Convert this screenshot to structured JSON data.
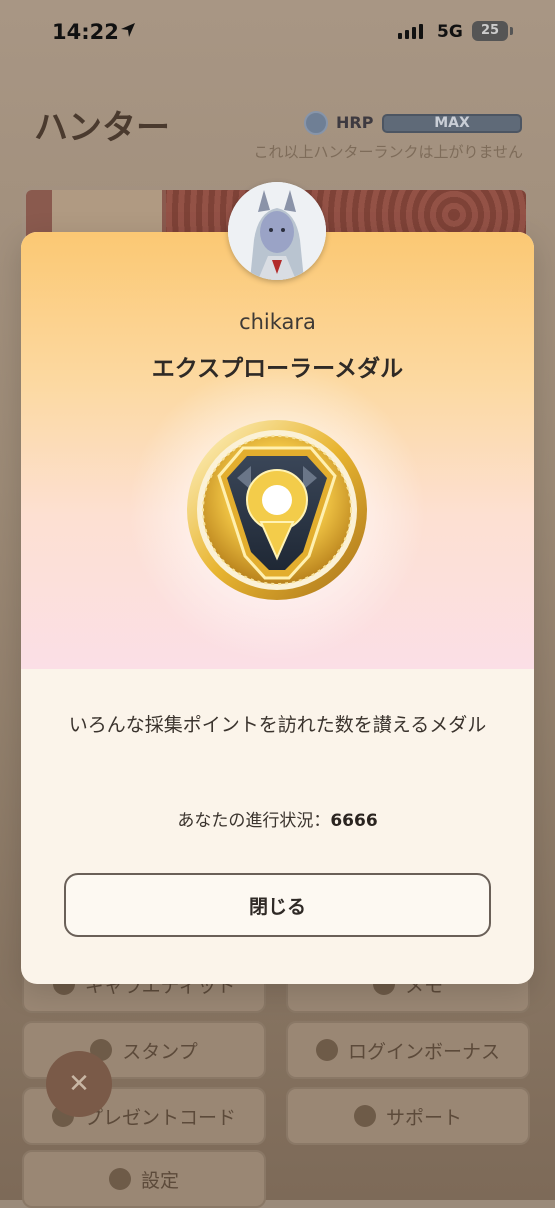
{
  "status_bar": {
    "time": "14:22",
    "network": "5G",
    "battery": "25"
  },
  "background_app": {
    "title": "ハンター",
    "hrp_label": "HRP",
    "hrp_value": "MAX",
    "rank_note": "これ以上ハンターランクは上がりません",
    "menu": [
      {
        "label": "キャラエディット",
        "icon": "character-icon"
      },
      {
        "label": "メモ",
        "icon": "memo-icon"
      },
      {
        "label": "スタンプ",
        "icon": "smiley-icon"
      },
      {
        "label": "ログインボーナス",
        "icon": "bonus-icon"
      },
      {
        "label": "プレゼントコード",
        "icon": "gift-icon"
      },
      {
        "label": "サポート",
        "icon": "help-icon"
      },
      {
        "label": "設定",
        "icon": "gear-icon"
      }
    ]
  },
  "modal": {
    "player_name": "chikara",
    "medal_title": "エクスプローラーメダル",
    "description": "いろんな採集ポイントを訪れた数を讃えるメダル",
    "progress_label": "あなたの進行状況：",
    "progress_value": "6666",
    "close_label": "閉じる"
  },
  "colors": {
    "modal_gradient_top": "#fbc873",
    "modal_gradient_bottom": "#fbdfe6",
    "medal_gold": "#e9b93a",
    "medal_navy": "#2a3544"
  }
}
